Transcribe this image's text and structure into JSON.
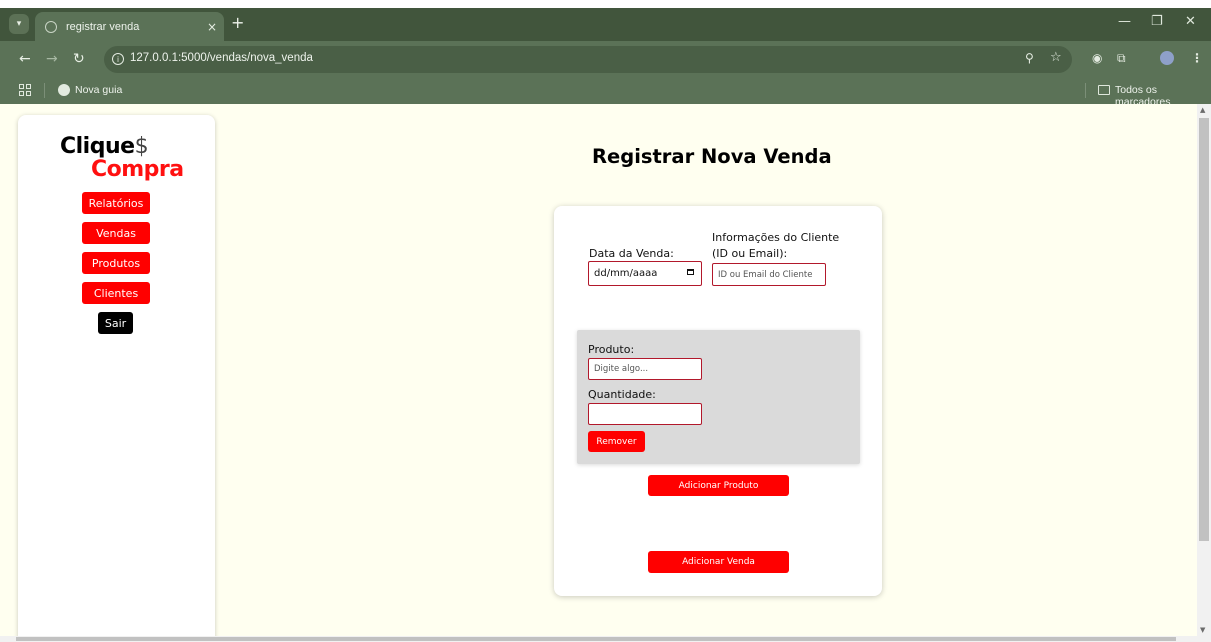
{
  "browser": {
    "tab_title": "registrar venda",
    "new_tab_symbol": "+",
    "tab_close_symbol": "×",
    "url": "127.0.0.1:5000/vendas/nova_venda",
    "bookmarks": {
      "nova_guia": "Nova guia",
      "todos_marcadores": "Todos os marcadores"
    },
    "icons": [
      "tab-search-icon",
      "globe-icon",
      "back-icon",
      "forward-icon",
      "reload-icon",
      "site-info-icon",
      "zoom-icon",
      "bookmark-star-icon",
      "extension-icon",
      "puzzle-icon",
      "profile-avatar-icon",
      "menu-icon",
      "apps-grid-icon",
      "folder-icon",
      "minimize-icon",
      "restore-icon",
      "close-icon"
    ]
  },
  "logo": {
    "word1": "Clique",
    "symbol": "$",
    "word2": "Compra"
  },
  "sidebar": {
    "items": [
      {
        "label": "Relatórios"
      },
      {
        "label": "Vendas"
      },
      {
        "label": "Produtos"
      },
      {
        "label": "Clientes"
      },
      {
        "label": "Sair"
      }
    ]
  },
  "page": {
    "title": "Registrar Nova Venda"
  },
  "form": {
    "date_label": "Data da Venda:",
    "date_placeholder": "dd/mm/aaaa",
    "client_label_line1": "Informações do Cliente",
    "client_label_line2": "(ID ou Email):",
    "client_placeholder": "ID ou Email do Cliente",
    "product_label": "Produto:",
    "product_placeholder": "Digite algo...",
    "quantity_label": "Quantidade:",
    "quantity_value": "",
    "remove_button": "Remover",
    "add_product_button": "Adicionar Produto",
    "add_sale_button": "Adicionar Venda"
  },
  "colors": {
    "accent": "#ff0000",
    "page_background": "#fffff0",
    "browser_frame": "#41553c",
    "toolbar": "#5b7257"
  }
}
